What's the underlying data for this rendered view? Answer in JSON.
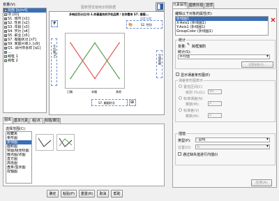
{
  "variables": {
    "label": "变量(V):",
    "items": [
      {
        "label": "局部 [b/m4]",
        "type": "scale",
        "selected": true
      },
      {
        "label": "ID [ID]",
        "type": "scale"
      },
      {
        "label": "S1. 城市 [s1]",
        "type": "nominal"
      },
      {
        "label": "S2. 性别 [s2]",
        "type": "nominal"
      },
      {
        "label": "S3. 年龄 [s3]",
        "type": "scale"
      },
      {
        "label": "S4. 学历 [s4]",
        "type": "nominal"
      },
      {
        "label": "S5. 职业 [s5]",
        "type": "nominal"
      },
      {
        "label": "S7. 婚姻状况 [s7]",
        "type": "nominal"
      },
      {
        "label": "S9. 家庭月收入 [s9]",
        "type": "nominal"
      },
      {
        "label": "Q1. 请问你喜欢 [q1]",
        "type": "nominal"
      },
      {
        "label": "…",
        "type": "nominal"
      },
      {
        "label": "跨框 1",
        "type": "set"
      },
      {
        "label": "跨框 2",
        "type": "set"
      }
    ]
  },
  "preview": {
    "hint": "图表预览使用示例数据",
    "chart_title": "多响应百分比(Q-1.你最喜欢的手机品牌 / 在你看来 S7. 婚姻...",
    "x_drop": "S7. 婚姻状况",
    "y_drop": "平均值(%)",
    "color_drop": "S2. 性别",
    "filter_drop": "过滤?",
    "legend_drop": "自定义组",
    "side_drop": "分组依据",
    "x_ticks": [
      "已婚",
      "未婚",
      "其他"
    ]
  },
  "chart_data": {
    "type": "line",
    "categories": [
      "已婚",
      "未婚",
      "其他"
    ],
    "series": [
      {
        "values": [
          10,
          90,
          10
        ],
        "color": "#59a14f"
      },
      {
        "values": [
          90,
          10,
          90
        ],
        "color": "#e15759"
      }
    ],
    "ylim": [
      0,
      100
    ]
  },
  "gallery": {
    "tabs": [
      "图库",
      "基本元素",
      "组/点 ID",
      "标题/脚注"
    ],
    "active_tab": 0,
    "choose_label": "选择范围(C):",
    "types": [
      "收藏夹",
      "条形图",
      "折线图",
      "面积图",
      "饼图/极坐标图",
      "散点图/点图",
      "直方图",
      "高低图",
      "盘条/盒状图",
      "双轴图"
    ],
    "selected_type": 2
  },
  "buttons": {
    "ok": "确定",
    "paste": "粘贴(P)",
    "reset": "重置(R)",
    "cancel": "取消",
    "help": "帮助"
  },
  "props": {
    "tabs": [
      "元素属性",
      "图表外观",
      "选项"
    ],
    "active_tab": 0,
    "edit_label": "编辑以下对象的属性(E):",
    "objects": [
      "折线图1",
      "X-Axis1 (折线图1)",
      "Y-Axis1 (折线图1)",
      "GroupColor (折线图1)"
    ],
    "selected_object": 0,
    "stats_group": "统计",
    "variable_label": "变量:",
    "variable_value": "跨框饿酌",
    "stat_label": "统计(S):",
    "stat_value": "平均值",
    "set_params": "设置参数(A)...",
    "show_error_bars": "显示误差条形图(E)",
    "errbar_group": "误差条形图表示",
    "ci_label": "置信区间(C)",
    "level_label": "级别 (%)(L):",
    "level_value": "95",
    "se_label": "标准误差(N)",
    "se_mult_label": "乘数(M):",
    "se_mult_value": "2",
    "sd_label": "标准差(V)",
    "sd_mult_label": "乘数(M):",
    "sd_mult_value": "2",
    "interp_group": "插值",
    "type_label": "类型(P):",
    "type_value": "直线",
    "pos_label": "位置(O):",
    "pos_value": "左",
    "cross_missing": "通过缺失值进行内插(I)",
    "apply": "应用(A)"
  }
}
